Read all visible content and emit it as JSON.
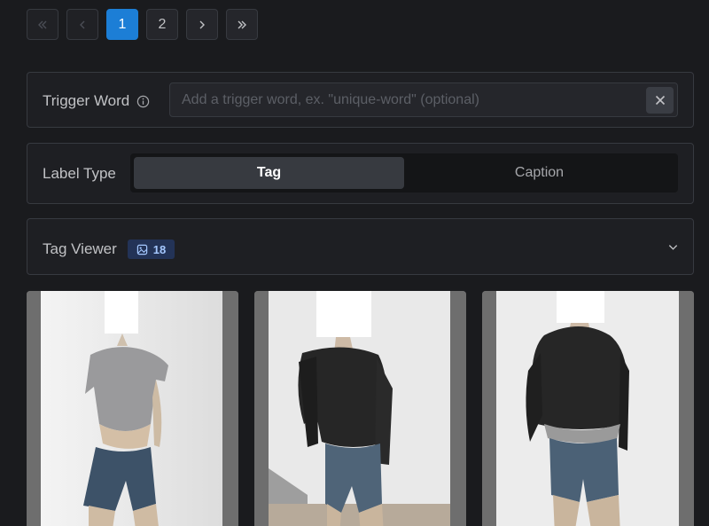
{
  "pagination": {
    "pages": [
      "1",
      "2"
    ],
    "current": "1",
    "first_icon": "chevrons-left-icon",
    "prev_icon": "chevron-left-icon",
    "next_icon": "chevron-right-icon",
    "last_icon": "chevrons-right-icon"
  },
  "trigger": {
    "label": "Trigger Word",
    "placeholder": "Add a trigger word, ex. \"unique-word\" (optional)",
    "value": "",
    "info_icon": "info-icon",
    "clear_icon": "close-icon"
  },
  "label_type": {
    "label": "Label Type",
    "options": [
      "Tag",
      "Caption"
    ],
    "selected": "Tag"
  },
  "tag_viewer": {
    "label": "Tag Viewer",
    "count": "18",
    "badge_icon": "image-icon",
    "toggle_icon": "chevron-down-icon"
  },
  "images": [
    {
      "name": "training-image-1"
    },
    {
      "name": "training-image-2"
    },
    {
      "name": "training-image-3"
    }
  ],
  "colors": {
    "background": "#1a1b1e",
    "accent": "#1c7ed6",
    "badge_bg": "#233357",
    "badge_text": "#a5c8ff"
  }
}
